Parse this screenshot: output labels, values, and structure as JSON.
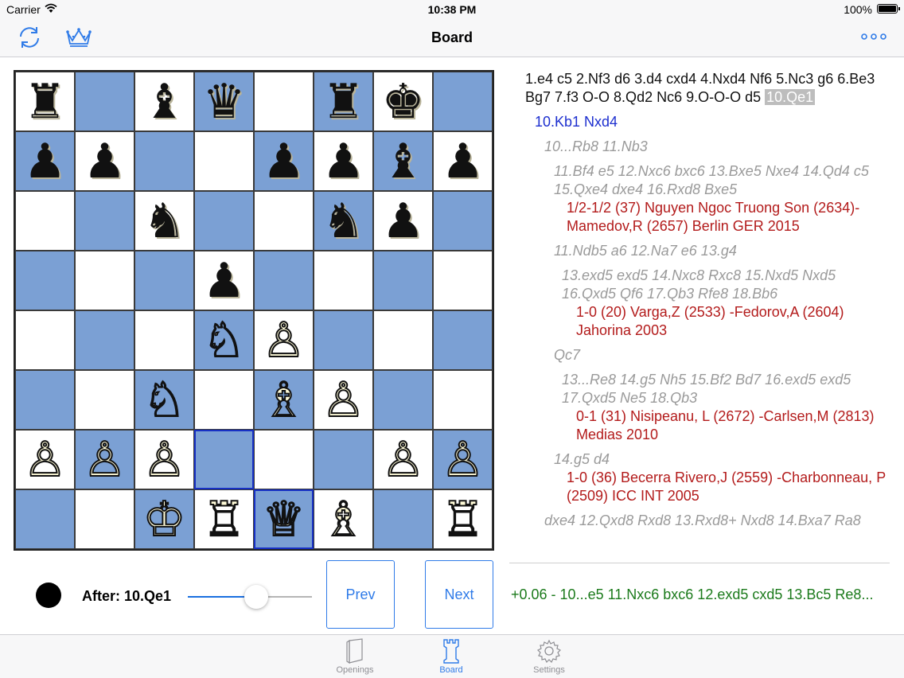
{
  "status": {
    "carrier": "Carrier",
    "time": "10:38 PM",
    "battery": "100%"
  },
  "nav": {
    "title": "Board"
  },
  "board": {
    "squares": [
      [
        "♜",
        "",
        "♝",
        "♛",
        "",
        "♜",
        "♚",
        ""
      ],
      [
        "♟",
        "♟",
        "",
        "",
        "♟",
        "♟",
        "♝",
        "♟"
      ],
      [
        "",
        "",
        "♞",
        "",
        "",
        "♞",
        "♟",
        ""
      ],
      [
        "",
        "",
        "",
        "♟",
        "",
        "",
        "",
        ""
      ],
      [
        "",
        "",
        "",
        "♘",
        "♙",
        "",
        "",
        ""
      ],
      [
        "",
        "",
        "♘",
        "",
        "♗",
        "♙",
        "",
        ""
      ],
      [
        "♙",
        "♙",
        "♙",
        "",
        "",
        "",
        "♙",
        "♙"
      ],
      [
        "",
        "",
        "♔",
        "♖",
        "♕",
        "♗",
        "",
        "♖"
      ]
    ],
    "colors": [
      [
        "b",
        "",
        "b",
        "b",
        "",
        "b",
        "b",
        ""
      ],
      [
        "b",
        "b",
        "",
        "",
        "b",
        "b",
        "b",
        "b"
      ],
      [
        "",
        "",
        "b",
        "",
        "",
        "b",
        "b",
        ""
      ],
      [
        "",
        "",
        "",
        "b",
        "",
        "",
        "",
        ""
      ],
      [
        "",
        "",
        "",
        "w",
        "w",
        "",
        "",
        ""
      ],
      [
        "",
        "",
        "w",
        "",
        "w",
        "w",
        "",
        ""
      ],
      [
        "w",
        "w",
        "w",
        "",
        "",
        "",
        "w",
        "w"
      ],
      [
        "",
        "",
        "w",
        "w",
        "w",
        "w",
        "",
        "w"
      ]
    ],
    "highlight": [
      [
        6,
        3
      ],
      [
        7,
        4
      ]
    ]
  },
  "moves": {
    "main_line": "1.e4 c5 2.Nf3 d6 3.d4 cxd4 4.Nxd4 Nf6 5.Nc3 g6 6.Be3 Bg7 7.f3 O-O 8.Qd2 Nc6 9.O-O-O d5 ",
    "current_move": "10.Qe1",
    "variation": "10.Kb1 Nxd4",
    "v1": "10...Rb8 11.Nb3",
    "v1a": "11.Bf4 e5 12.Nxc6 bxc6 13.Bxe5 Nxe4 14.Qd4 c5 15.Qxe4 dxe4 16.Rxd8 Bxe5",
    "g1": "1/2-1/2 (37) Nguyen Ngoc Truong Son (2634)-Mamedov,R (2657) Berlin GER 2015",
    "v1b": "11.Ndb5 a6 12.Na7 e6 13.g4",
    "v1b1": "13.exd5 exd5 14.Nxc8 Rxc8 15.Nxd5 Nxd5 16.Qxd5 Qf6 17.Qb3 Rfe8 18.Bb6",
    "g2": "1-0 (20) Varga,Z (2533) -Fedorov,A (2604) Jahorina 2003",
    "v1c": "Qc7",
    "v1c1": "13...Re8 14.g5 Nh5 15.Bf2 Bd7 16.exd5 exd5 17.Qxd5 Ne5 18.Qb3",
    "g3": "0-1 (31) Nisipeanu, L (2672) -Carlsen,M (2813) Medias 2010",
    "v1d": "14.g5 d4",
    "g4": "1-0 (36) Becerra Rivero,J (2559) -Charbonneau, P (2509) ICC INT 2005",
    "v2": "dxe4 12.Qxd8 Rxd8 13.Rxd8+ Nxd8 14.Bxa7 Ra8"
  },
  "controls": {
    "after_label": "After: 10.Qe1",
    "slider_value": 0.55,
    "prev_label": "Prev",
    "next_label": "Next",
    "engine_line": "+0.06 - 10...e5 11.Nxc6 bxc6 12.exd5 cxd5 13.Bc5 Re8..."
  },
  "tabs": {
    "openings": "Openings",
    "board": "Board",
    "settings": "Settings"
  },
  "colors": {
    "accent": "#2f7be8",
    "dark_square": "#7ba0d4",
    "variation": "#1d2fcf",
    "game_ref": "#b31b1b",
    "engine": "#1b7a1b"
  }
}
